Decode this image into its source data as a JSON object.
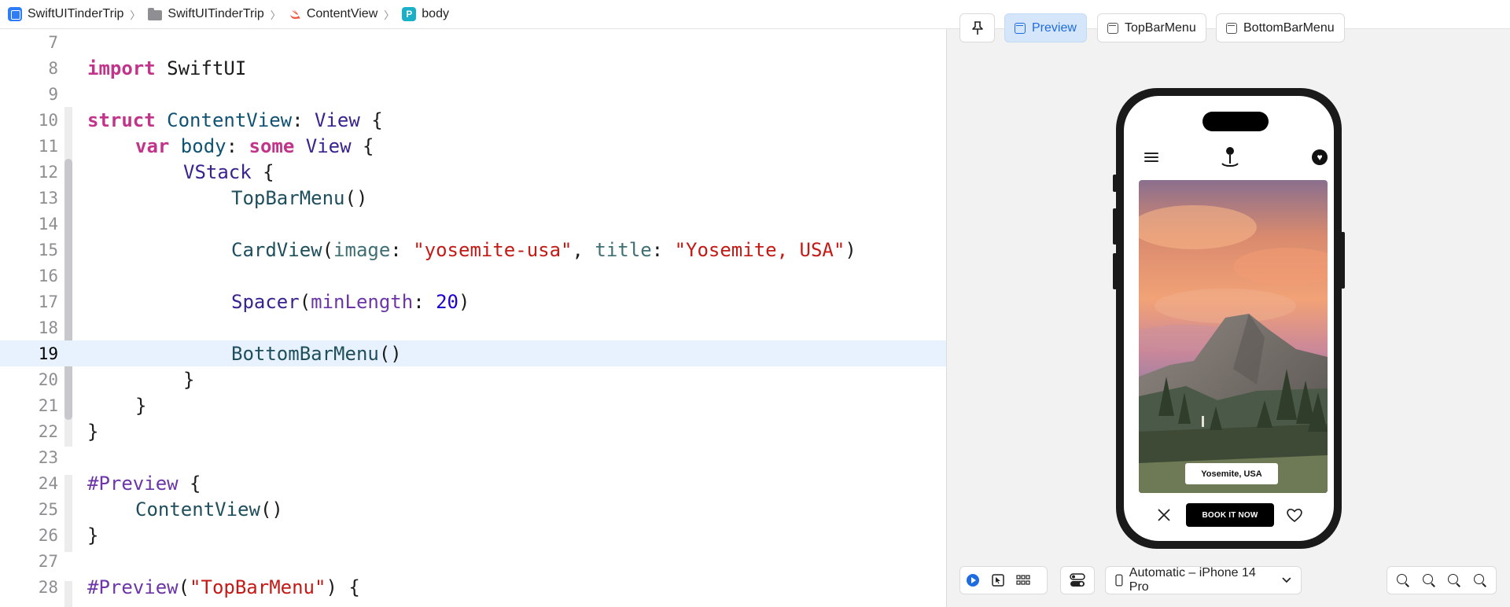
{
  "breadcrumb": {
    "items": [
      {
        "label": "SwiftUITinderTrip",
        "icon": "app-icon"
      },
      {
        "label": "SwiftUITinderTrip",
        "icon": "folder-icon"
      },
      {
        "label": "ContentView",
        "icon": "swift-file-icon"
      },
      {
        "label": "body",
        "icon": "property-icon",
        "icon_letter": "P"
      }
    ],
    "separator": "〉"
  },
  "editor": {
    "current_line": "19",
    "line_numbers": [
      "7",
      "8",
      "9",
      "10",
      "11",
      "12",
      "13",
      "14",
      "15",
      "16",
      "17",
      "18",
      "19",
      "20",
      "21",
      "22",
      "23",
      "24",
      "25",
      "26",
      "27",
      "28"
    ],
    "code": {
      "l8_kw": "import",
      "l8_mod": " SwiftUI",
      "l10_kw": "struct",
      "l10_name": " ContentView",
      "l10_colon": ": ",
      "l10_type": "View",
      "l10_brace": " {",
      "l11_kw1": "var",
      "l11_name": " body",
      "l11_colon": ": ",
      "l11_kw2": "some",
      "l11_type": " View",
      "l11_brace": " {",
      "l12_type": "VStack",
      "l12_brace": " {",
      "l13_call": "TopBarMenu",
      "l13_paren": "()",
      "l15_call": "CardView",
      "l15_p1": "(",
      "l15_arg1": "image",
      "l15_c1": ": ",
      "l15_s1": "\"yosemite-usa\"",
      "l15_comma": ", ",
      "l15_arg2": "title",
      "l15_c2": ": ",
      "l15_s2": "\"Yosemite, USA\"",
      "l15_p2": ")",
      "l17_call": "Spacer",
      "l17_p1": "(",
      "l17_arg": "minLength",
      "l17_c": ": ",
      "l17_num": "20",
      "l17_p2": ")",
      "l19_call": "BottomBarMenu",
      "l19_paren": "()",
      "l20": "}",
      "l21": "}",
      "l22": "}",
      "l24_macro": "#Preview",
      "l24_brace": " {",
      "l25_call": "ContentView",
      "l25_paren": "()",
      "l26": "}",
      "l28_macro": "#Preview",
      "l28_p1": "(",
      "l28_str": "\"TopBarMenu\"",
      "l28_p2": ") {"
    }
  },
  "preview_tabs": {
    "pin_icon": "pin-icon",
    "tabs": [
      {
        "label": "Preview",
        "active": true
      },
      {
        "label": "TopBarMenu",
        "active": false
      },
      {
        "label": "BottomBarMenu",
        "active": false
      }
    ]
  },
  "phone": {
    "card_title": "Yosemite, USA",
    "book_button": "BOOK IT NOW"
  },
  "bottom_toolbar": {
    "device_label": "Automatic – iPhone 14 Pro",
    "zoom_icons": [
      "zoom-out-icon",
      "zoom-fit-icon",
      "zoom-100-icon",
      "zoom-in-icon"
    ]
  },
  "colors": {
    "keyword": "#c1348a",
    "string": "#c41a16",
    "number": "#1c00cf",
    "highlight_line": "#e8f2fe",
    "active_tab": "#d5e6fb",
    "canvas": "#f2f2f2"
  }
}
